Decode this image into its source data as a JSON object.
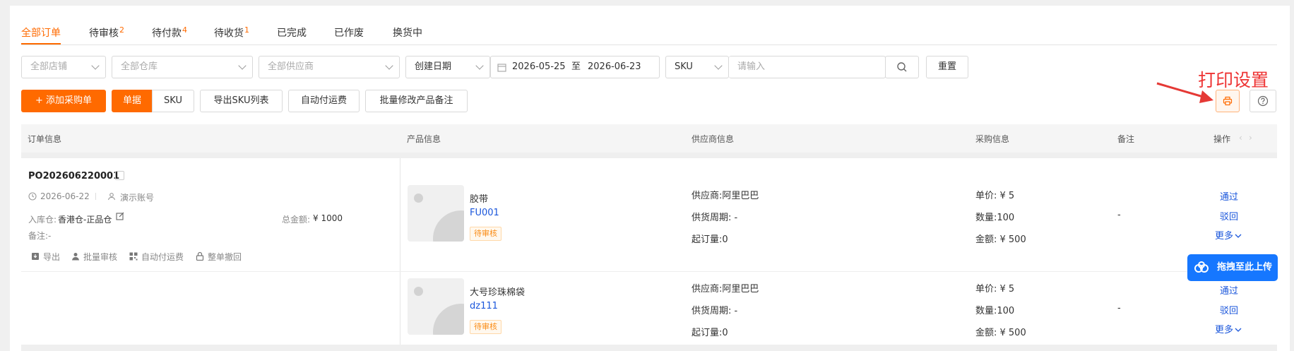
{
  "tabs": [
    {
      "label": "全部订单"
    },
    {
      "label": "待审核",
      "count": "2"
    },
    {
      "label": "待付款",
      "count": "4"
    },
    {
      "label": "待收货",
      "count": "1"
    },
    {
      "label": "已完成"
    },
    {
      "label": "已作废"
    },
    {
      "label": "换货中"
    }
  ],
  "filters": {
    "store": "全部店铺",
    "warehouse": "全部仓库",
    "supplier": "全部供应商",
    "date_type": "创建日期",
    "date_from": "2026-05-25",
    "date_sep": "至",
    "date_to": "2026-06-23",
    "search_field": "SKU",
    "search_placeholder": "请输入",
    "reset": "重置"
  },
  "toolbar": {
    "add_po": "+ 添加采购单",
    "view_doc": "单据",
    "view_sku": "SKU",
    "export_sku": "导出SKU列表",
    "auto_freight": "自动付运费",
    "batch_note": "批量修改产品备注"
  },
  "annotation": {
    "label": "打印设置",
    "color": "#e53935"
  },
  "columns": {
    "order": "订单信息",
    "product": "产品信息",
    "supplier": "供应商信息",
    "purchase": "采购信息",
    "note": "备注",
    "action": "操作"
  },
  "order": {
    "id": "PO202606220001",
    "date": "2026-06-22",
    "account": "演示账号",
    "warehouse_label": "入库仓:",
    "warehouse": "香港仓-正品仓",
    "total_label": "总金额:",
    "total": "¥ 1000",
    "remark": "备注:-",
    "actions": {
      "export": "导出",
      "batch_review": "批量审核",
      "auto_freight": "自动付运费",
      "revoke": "整单撤回"
    }
  },
  "items": [
    {
      "name": "胶带",
      "sku": "FU001",
      "status": "待审核",
      "supplier": "供应商:阿里巴巴",
      "lead_time": "供货周期:  -",
      "moq": "起订量:0",
      "price": "单价: ¥ 5",
      "qty": "数量:100",
      "amount": "金额: ¥ 500",
      "note": "-",
      "approve": "通过",
      "reject": "驳回",
      "more": "更多"
    },
    {
      "name": "大号珍珠棉袋",
      "sku": "dz111",
      "status": "待审核",
      "supplier": "供应商:阿里巴巴",
      "lead_time": "供货周期:  -",
      "moq": "起订量:0",
      "price": "单价: ¥ 5",
      "qty": "数量:100",
      "amount": "金额: ¥ 500",
      "note": "-",
      "approve": "通过",
      "reject": "驳回",
      "more": "更多"
    }
  ],
  "upload_widget": "拖拽至此上传"
}
